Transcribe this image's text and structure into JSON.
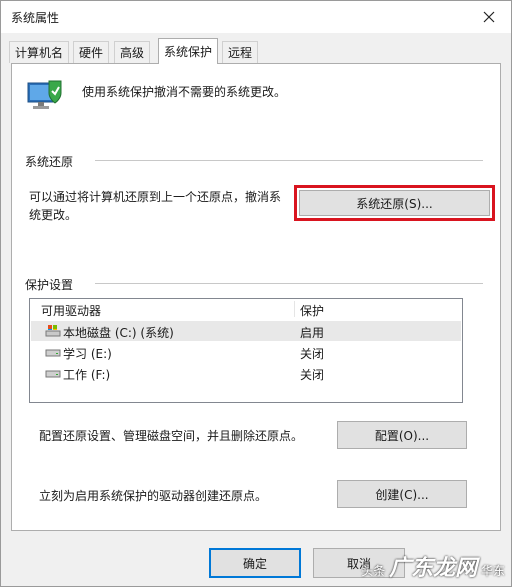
{
  "window": {
    "title": "系统属性"
  },
  "tabs": [
    "计算机名",
    "硬件",
    "高级",
    "系统保护",
    "远程"
  ],
  "intro": {
    "text": "使用系统保护撤消不需要的系统更改。"
  },
  "restore": {
    "heading": "系统还原",
    "desc_line1": "可以通过将计算机还原到上一个还原点，撤消系",
    "desc_line2": "统更改。",
    "button": "系统还原(S)..."
  },
  "protection": {
    "heading": "保护设置",
    "col_drive": "可用驱动器",
    "col_status": "保护",
    "drives": [
      {
        "name": "本地磁盘 (C:) (系统)",
        "status": "启用"
      },
      {
        "name": "学习 (E:)",
        "status": "关闭"
      },
      {
        "name": "工作 (F:)",
        "status": "关闭"
      }
    ],
    "configure_text": "配置还原设置、管理磁盘空间，并且删除还原点。",
    "configure_button": "配置(O)...",
    "create_text": "立刻为启用系统保护的驱动器创建还原点。",
    "create_button": "创建(C)..."
  },
  "footer": {
    "ok": "确定",
    "cancel": "取消"
  },
  "watermark": {
    "prefix": "头条",
    "brand": "广东龙网",
    "suffix": "华东"
  },
  "colors": {
    "highlight": "#d9141f",
    "accent": "#0078d7"
  }
}
